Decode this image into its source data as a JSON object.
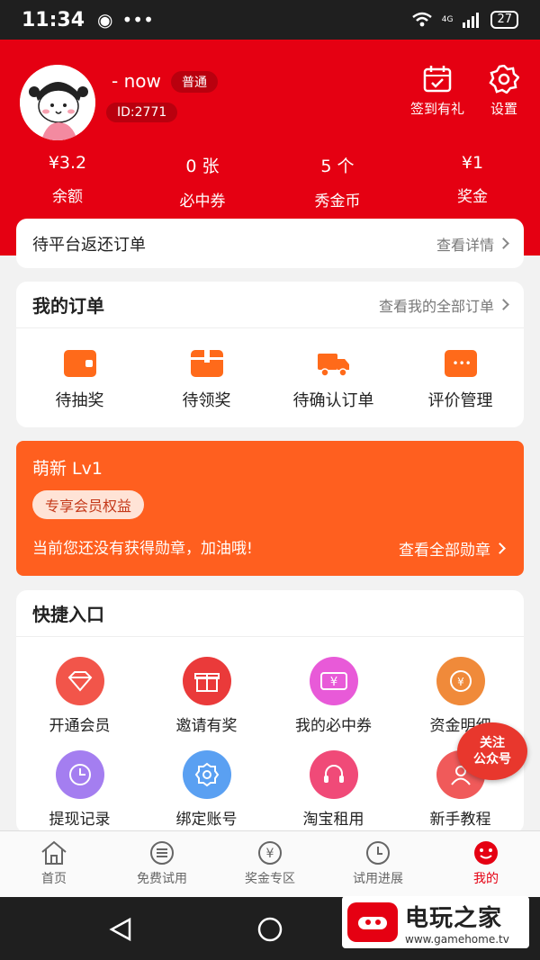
{
  "status_bar": {
    "time": "11:34",
    "battery": "27",
    "network": "4G"
  },
  "profile": {
    "nickname": "- now",
    "level_badge": "普通",
    "user_id": "ID:2771"
  },
  "header_buttons": {
    "checkin_label": "签到有礼",
    "settings_label": "设置"
  },
  "stats": [
    {
      "value": "¥3.2",
      "label": "余额"
    },
    {
      "value": "0 张",
      "label": "必中券"
    },
    {
      "value": "5 个",
      "label": "秀金币"
    },
    {
      "value": "¥1",
      "label": "奖金"
    }
  ],
  "pending": {
    "title": "待平台返还订单",
    "link": "查看详情"
  },
  "orders": {
    "title": "我的订单",
    "link": "查看我的全部订单",
    "items": [
      {
        "label": "待抽奖",
        "icon": "wallet-icon"
      },
      {
        "label": "待领奖",
        "icon": "box-icon"
      },
      {
        "label": "待确认订单",
        "icon": "truck-icon"
      },
      {
        "label": "评价管理",
        "icon": "comment-icon"
      }
    ]
  },
  "level_card": {
    "title": "萌新 Lv1",
    "perk": "专享会员权益",
    "message": "当前您还没有获得勋章，加油哦!",
    "link": "查看全部勋章"
  },
  "quick": {
    "title": "快捷入口",
    "items": [
      {
        "label": "开通会员",
        "icon": "diamond-icon",
        "color": "#f2554a"
      },
      {
        "label": "邀请有奖",
        "icon": "gift-icon",
        "color": "#ea3a3a"
      },
      {
        "label": "我的必中券",
        "icon": "coupon-icon",
        "color": "#e85ad8"
      },
      {
        "label": "资金明细",
        "icon": "piggy-bank-icon",
        "color": "#f08a3a"
      },
      {
        "label": "提现记录",
        "icon": "clock-icon",
        "color": "#a47ef0"
      },
      {
        "label": "绑定账号",
        "icon": "gear-icon",
        "color": "#5aa0f2"
      },
      {
        "label": "淘宝租用",
        "icon": "headset-icon",
        "color": "#f04a78"
      },
      {
        "label": "新手教程",
        "icon": "user-icon",
        "color": "#f05a5a"
      }
    ]
  },
  "follow_badge": {
    "line1": "关注",
    "line2": "公众号"
  },
  "tabs": [
    {
      "label": "首页",
      "icon": "home-icon"
    },
    {
      "label": "免费试用",
      "icon": "list-icon"
    },
    {
      "label": "奖金专区",
      "icon": "yen-icon"
    },
    {
      "label": "试用进展",
      "icon": "clock-icon"
    },
    {
      "label": "我的",
      "icon": "smile-icon",
      "active": true
    }
  ],
  "watermark": {
    "title": "电玩之家",
    "url": "www.gamehome.tv"
  },
  "colors": {
    "brand_red": "#e50012",
    "orange": "#ff5f1f"
  }
}
